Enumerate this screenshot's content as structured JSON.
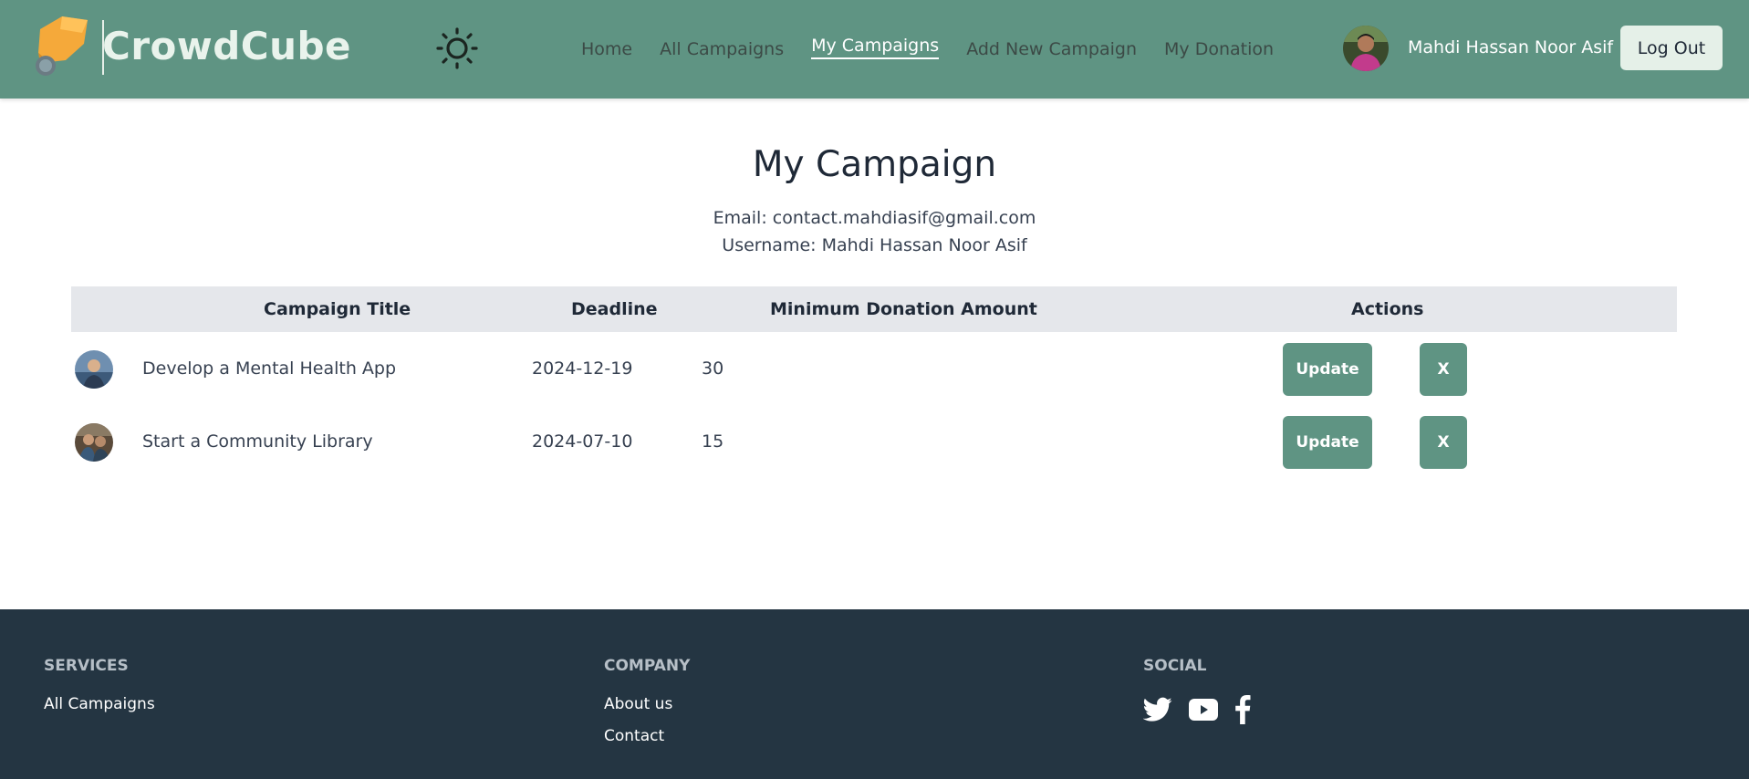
{
  "brand": {
    "name": "CrowdCube"
  },
  "nav": {
    "links": [
      {
        "label": "Home"
      },
      {
        "label": "All Campaigns"
      },
      {
        "label": "My Campaigns"
      },
      {
        "label": "Add New Campaign"
      },
      {
        "label": "My Donation"
      }
    ],
    "active_index": 2,
    "user_name": "Mahdi Hassan Noor Asif",
    "logout_label": "Log Out"
  },
  "main": {
    "title": "My Campaign",
    "email_line": "Email: contact.mahdiasif@gmail.com",
    "username_line": "Username: Mahdi Hassan Noor Asif"
  },
  "table": {
    "headers": {
      "title": "Campaign Title",
      "deadline": "Deadline",
      "min_donation": "Minimum Donation Amount",
      "actions": "Actions"
    },
    "rows": [
      {
        "title": "Develop a Mental Health App",
        "deadline": "2024-12-19",
        "min_donation": "30",
        "update_label": "Update",
        "delete_label": "X"
      },
      {
        "title": "Start a Community Library",
        "deadline": "2024-07-10",
        "min_donation": "15",
        "update_label": "Update",
        "delete_label": "X"
      }
    ]
  },
  "footer": {
    "services": {
      "heading": "SERVICES",
      "links": [
        "All Campaigns"
      ]
    },
    "company": {
      "heading": "COMPANY",
      "links": [
        "About us",
        "Contact"
      ]
    },
    "social": {
      "heading": "SOCIAL",
      "icons": [
        "twitter-icon",
        "youtube-icon",
        "facebook-icon"
      ]
    }
  },
  "colors": {
    "nav_bg": "#5f9483",
    "accent": "#5f9483",
    "footer_bg": "#243542",
    "table_head_bg": "#e5e7eb"
  }
}
